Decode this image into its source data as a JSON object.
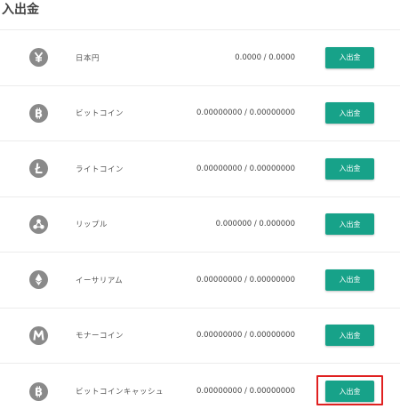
{
  "page": {
    "title": "入出金"
  },
  "button_label": "入出金",
  "accent_color": "#17a289",
  "icon_color": "#8a8a8a",
  "highlight_color": "#e02020",
  "rows": [
    {
      "name": "日本円",
      "balance": "0.0000 / 0.0000",
      "icon": "yen-icon"
    },
    {
      "name": "ビットコイン",
      "balance": "0.00000000 / 0.00000000",
      "icon": "bitcoin-icon"
    },
    {
      "name": "ライトコイン",
      "balance": "0.00000000 / 0.00000000",
      "icon": "litecoin-icon"
    },
    {
      "name": "リップル",
      "balance": "0.000000 / 0.000000",
      "icon": "ripple-icon"
    },
    {
      "name": "イーサリアム",
      "balance": "0.00000000 / 0.00000000",
      "icon": "ethereum-icon"
    },
    {
      "name": "モナーコイン",
      "balance": "0.00000000 / 0.00000000",
      "icon": "monacoin-icon"
    },
    {
      "name": "ビットコインキャッシュ",
      "balance": "0.00000000 / 0.00000000",
      "icon": "bitcoin-cash-icon"
    }
  ]
}
